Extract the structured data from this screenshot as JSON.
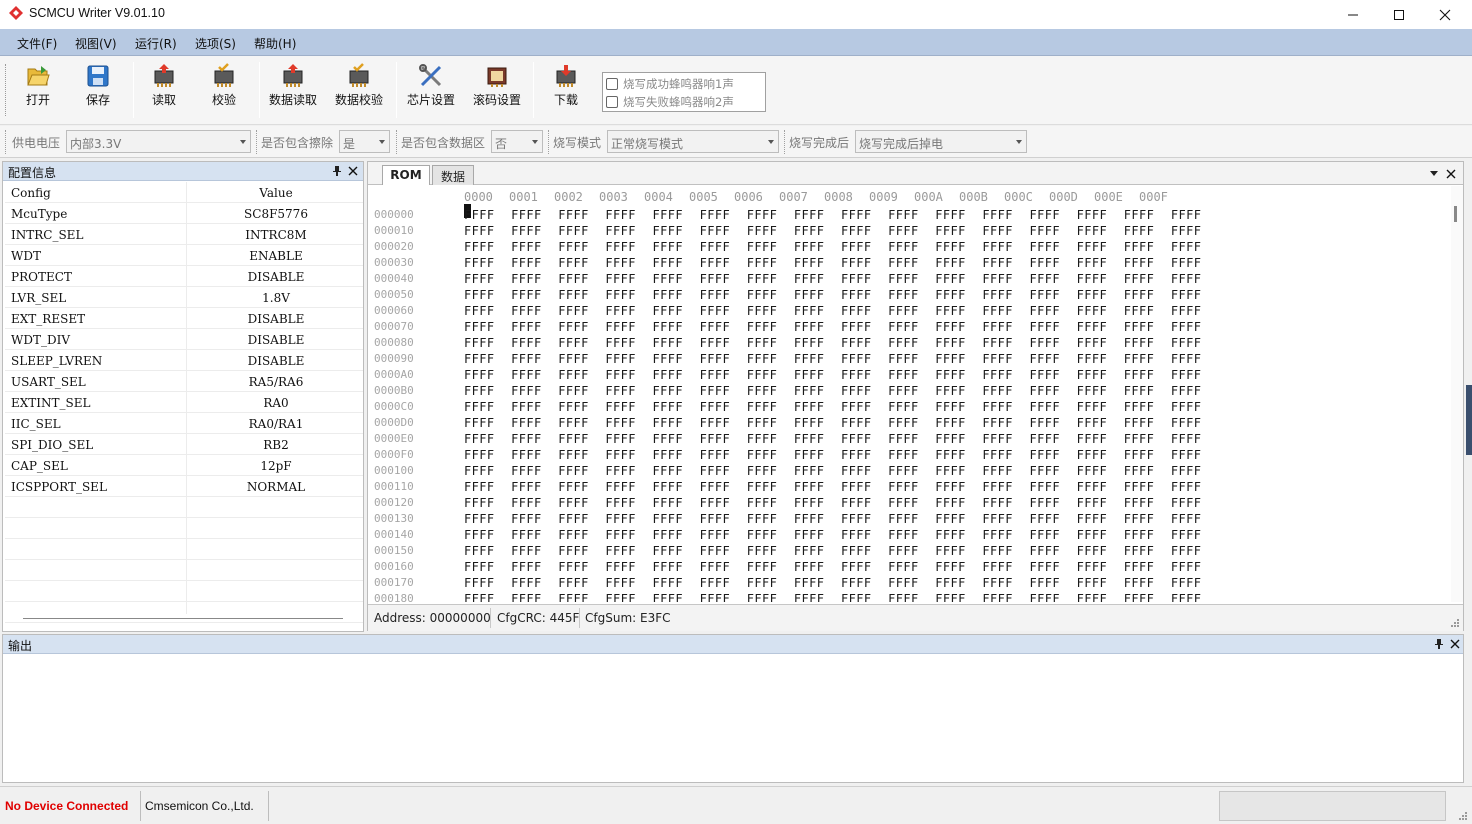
{
  "window": {
    "title": "SCMCU Writer V9.01.10",
    "controls": {
      "minimize_icon": "minimize-icon",
      "maximize_icon": "maximize-icon",
      "close_icon": "close-icon"
    }
  },
  "menu": [
    "文件(F)",
    "视图(V)",
    "运行(R)",
    "选项(S)",
    "帮助(H)"
  ],
  "toolbar": {
    "buttons": [
      {
        "label": "打开",
        "icon": "folder-open-icon"
      },
      {
        "label": "保存",
        "icon": "save-icon"
      },
      {
        "label": "读取",
        "icon": "chip-read-icon"
      },
      {
        "label": "校验",
        "icon": "chip-verify-icon"
      },
      {
        "label": "数据读取",
        "icon": "data-read-icon"
      },
      {
        "label": "数据校验",
        "icon": "data-verify-icon"
      },
      {
        "label": "芯片设置",
        "icon": "tools-icon"
      },
      {
        "label": "滚码设置",
        "icon": "rolling-code-icon"
      },
      {
        "label": "下载",
        "icon": "download-icon"
      }
    ],
    "beep": {
      "success": "烧写成功蜂鸣器响1声",
      "fail": "烧写失败蜂鸣器响2声"
    }
  },
  "options": {
    "voltage": {
      "label": "供电电压",
      "value": "内部3.3V"
    },
    "erase": {
      "label": "是否包含擦除",
      "value": "是"
    },
    "data_area": {
      "label": "是否包含数据区",
      "value": "否"
    },
    "mode": {
      "label": "烧写模式",
      "value": "正常烧写模式"
    },
    "after": {
      "label": "烧写完成后",
      "value": "烧写完成后掉电"
    }
  },
  "config_panel": {
    "title": "配置信息",
    "header": {
      "config": "Config",
      "value": "Value"
    },
    "rows": [
      {
        "config": "McuType",
        "value": "SC8F5776"
      },
      {
        "config": "INTRC_SEL",
        "value": "INTRC8M"
      },
      {
        "config": "WDT",
        "value": "ENABLE"
      },
      {
        "config": "PROTECT",
        "value": "DISABLE"
      },
      {
        "config": "LVR_SEL",
        "value": "1.8V"
      },
      {
        "config": "EXT_RESET",
        "value": "DISABLE"
      },
      {
        "config": "WDT_DIV",
        "value": "DISABLE"
      },
      {
        "config": "SLEEP_LVREN",
        "value": "DISABLE"
      },
      {
        "config": "USART_SEL",
        "value": "RA5/RA6"
      },
      {
        "config": "EXTINT_SEL",
        "value": "RA0"
      },
      {
        "config": "IIC_SEL",
        "value": "RA0/RA1"
      },
      {
        "config": "SPI_DIO_SEL",
        "value": "RB2"
      },
      {
        "config": "CAP_SEL",
        "value": "12pF"
      },
      {
        "config": "ICSPPORT_SEL",
        "value": "NORMAL"
      }
    ]
  },
  "rom_panel": {
    "tabs": [
      "ROM",
      "数据"
    ],
    "active_tab": "ROM",
    "columns": [
      "0000",
      "0001",
      "0002",
      "0003",
      "0004",
      "0005",
      "0006",
      "0007",
      "0008",
      "0009",
      "000A",
      "000B",
      "000C",
      "000D",
      "000E",
      "000F"
    ],
    "rows": [
      {
        "addr": "000000",
        "data": "FFFF FFFF FFFF FFFF FFFF FFFF FFFF FFFF FFFF FFFF FFFF FFFF FFFF FFFF FFFF FFFF"
      },
      {
        "addr": "000010",
        "data": "FFFF FFFF FFFF FFFF FFFF FFFF FFFF FFFF FFFF FFFF FFFF FFFF FFFF FFFF FFFF FFFF"
      },
      {
        "addr": "000020",
        "data": "FFFF FFFF FFFF FFFF FFFF FFFF FFFF FFFF FFFF FFFF FFFF FFFF FFFF FFFF FFFF FFFF"
      },
      {
        "addr": "000030",
        "data": "FFFF FFFF FFFF FFFF FFFF FFFF FFFF FFFF FFFF FFFF FFFF FFFF FFFF FFFF FFFF FFFF"
      },
      {
        "addr": "000040",
        "data": "FFFF FFFF FFFF FFFF FFFF FFFF FFFF FFFF FFFF FFFF FFFF FFFF FFFF FFFF FFFF FFFF"
      },
      {
        "addr": "000050",
        "data": "FFFF FFFF FFFF FFFF FFFF FFFF FFFF FFFF FFFF FFFF FFFF FFFF FFFF FFFF FFFF FFFF"
      },
      {
        "addr": "000060",
        "data": "FFFF FFFF FFFF FFFF FFFF FFFF FFFF FFFF FFFF FFFF FFFF FFFF FFFF FFFF FFFF FFFF"
      },
      {
        "addr": "000070",
        "data": "FFFF FFFF FFFF FFFF FFFF FFFF FFFF FFFF FFFF FFFF FFFF FFFF FFFF FFFF FFFF FFFF"
      },
      {
        "addr": "000080",
        "data": "FFFF FFFF FFFF FFFF FFFF FFFF FFFF FFFF FFFF FFFF FFFF FFFF FFFF FFFF FFFF FFFF"
      },
      {
        "addr": "000090",
        "data": "FFFF FFFF FFFF FFFF FFFF FFFF FFFF FFFF FFFF FFFF FFFF FFFF FFFF FFFF FFFF FFFF"
      },
      {
        "addr": "0000A0",
        "data": "FFFF FFFF FFFF FFFF FFFF FFFF FFFF FFFF FFFF FFFF FFFF FFFF FFFF FFFF FFFF FFFF"
      },
      {
        "addr": "0000B0",
        "data": "FFFF FFFF FFFF FFFF FFFF FFFF FFFF FFFF FFFF FFFF FFFF FFFF FFFF FFFF FFFF FFFF"
      },
      {
        "addr": "0000C0",
        "data": "FFFF FFFF FFFF FFFF FFFF FFFF FFFF FFFF FFFF FFFF FFFF FFFF FFFF FFFF FFFF FFFF"
      },
      {
        "addr": "0000D0",
        "data": "FFFF FFFF FFFF FFFF FFFF FFFF FFFF FFFF FFFF FFFF FFFF FFFF FFFF FFFF FFFF FFFF"
      },
      {
        "addr": "0000E0",
        "data": "FFFF FFFF FFFF FFFF FFFF FFFF FFFF FFFF FFFF FFFF FFFF FFFF FFFF FFFF FFFF FFFF"
      },
      {
        "addr": "0000F0",
        "data": "FFFF FFFF FFFF FFFF FFFF FFFF FFFF FFFF FFFF FFFF FFFF FFFF FFFF FFFF FFFF FFFF"
      },
      {
        "addr": "000100",
        "data": "FFFF FFFF FFFF FFFF FFFF FFFF FFFF FFFF FFFF FFFF FFFF FFFF FFFF FFFF FFFF FFFF"
      },
      {
        "addr": "000110",
        "data": "FFFF FFFF FFFF FFFF FFFF FFFF FFFF FFFF FFFF FFFF FFFF FFFF FFFF FFFF FFFF FFFF"
      },
      {
        "addr": "000120",
        "data": "FFFF FFFF FFFF FFFF FFFF FFFF FFFF FFFF FFFF FFFF FFFF FFFF FFFF FFFF FFFF FFFF"
      },
      {
        "addr": "000130",
        "data": "FFFF FFFF FFFF FFFF FFFF FFFF FFFF FFFF FFFF FFFF FFFF FFFF FFFF FFFF FFFF FFFF"
      },
      {
        "addr": "000140",
        "data": "FFFF FFFF FFFF FFFF FFFF FFFF FFFF FFFF FFFF FFFF FFFF FFFF FFFF FFFF FFFF FFFF"
      },
      {
        "addr": "000150",
        "data": "FFFF FFFF FFFF FFFF FFFF FFFF FFFF FFFF FFFF FFFF FFFF FFFF FFFF FFFF FFFF FFFF"
      },
      {
        "addr": "000160",
        "data": "FFFF FFFF FFFF FFFF FFFF FFFF FFFF FFFF FFFF FFFF FFFF FFFF FFFF FFFF FFFF FFFF"
      },
      {
        "addr": "000170",
        "data": "FFFF FFFF FFFF FFFF FFFF FFFF FFFF FFFF FFFF FFFF FFFF FFFF FFFF FFFF FFFF FFFF"
      },
      {
        "addr": "000180",
        "data": "FFFF FFFF FFFF FFFF FFFF FFFF FFFF FFFF FFFF FFFF FFFF FFFF FFFF FFFF FFFF FFFF"
      }
    ],
    "status": {
      "address": "Address: 00000000",
      "cfg_crc": "CfgCRC: 445F",
      "cfg_sum": "CfgSum: E3FC"
    }
  },
  "output_panel": {
    "title": "输出"
  },
  "statusbar": {
    "connection": "No Device Connected",
    "company": "Cmsemicon Co.,Ltd."
  },
  "colors": {
    "menubar": "#b7c9e2",
    "panel_header": "#d6e2f1",
    "error": "#e00000",
    "brand": "#e03030"
  }
}
